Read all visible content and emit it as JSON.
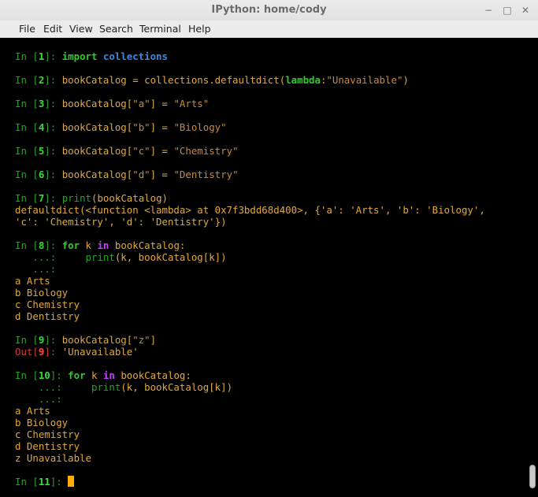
{
  "window": {
    "title": "IPython: home/cody",
    "controls": {
      "minimize": "−",
      "maximize": "□",
      "close": "✕"
    }
  },
  "menu": [
    "File",
    "Edit",
    "View",
    "Search",
    "Terminal",
    "Help"
  ],
  "lines": [
    {
      "kind": "prompt",
      "parts": [
        {
          "t": "In [",
          "c": "g"
        },
        {
          "t": "1",
          "c": "gb"
        },
        {
          "t": "]: ",
          "c": "g"
        },
        {
          "t": "import ",
          "c": "k"
        },
        {
          "t": "collections",
          "c": "b"
        }
      ]
    },
    {
      "kind": "blank"
    },
    {
      "kind": "prompt",
      "parts": [
        {
          "t": "In [",
          "c": "g"
        },
        {
          "t": "2",
          "c": "gb"
        },
        {
          "t": "]: ",
          "c": "g"
        },
        {
          "t": "bookCatalog = collections.defaultdict(",
          "c": "y"
        },
        {
          "t": "lambda",
          "c": "k"
        },
        {
          "t": ":",
          "c": "y"
        },
        {
          "t": "\"Unavailable\"",
          "c": "s"
        },
        {
          "t": ")",
          "c": "y"
        }
      ]
    },
    {
      "kind": "blank"
    },
    {
      "kind": "prompt",
      "parts": [
        {
          "t": "In [",
          "c": "g"
        },
        {
          "t": "3",
          "c": "gb"
        },
        {
          "t": "]: ",
          "c": "g"
        },
        {
          "t": "bookCatalog[",
          "c": "y"
        },
        {
          "t": "\"a\"",
          "c": "s"
        },
        {
          "t": "] = ",
          "c": "y"
        },
        {
          "t": "\"Arts\"",
          "c": "s"
        }
      ]
    },
    {
      "kind": "blank"
    },
    {
      "kind": "prompt",
      "parts": [
        {
          "t": "In [",
          "c": "g"
        },
        {
          "t": "4",
          "c": "gb"
        },
        {
          "t": "]: ",
          "c": "g"
        },
        {
          "t": "bookCatalog[",
          "c": "y"
        },
        {
          "t": "\"b\"",
          "c": "s"
        },
        {
          "t": "] = ",
          "c": "y"
        },
        {
          "t": "\"Biology\"",
          "c": "s"
        }
      ]
    },
    {
      "kind": "blank"
    },
    {
      "kind": "prompt",
      "parts": [
        {
          "t": "In [",
          "c": "g"
        },
        {
          "t": "5",
          "c": "gb"
        },
        {
          "t": "]: ",
          "c": "g"
        },
        {
          "t": "bookCatalog[",
          "c": "y"
        },
        {
          "t": "\"c\"",
          "c": "s"
        },
        {
          "t": "] = ",
          "c": "y"
        },
        {
          "t": "\"Chemistry\"",
          "c": "s"
        }
      ]
    },
    {
      "kind": "blank"
    },
    {
      "kind": "prompt",
      "parts": [
        {
          "t": "In [",
          "c": "g"
        },
        {
          "t": "6",
          "c": "gb"
        },
        {
          "t": "]: ",
          "c": "g"
        },
        {
          "t": "bookCatalog[",
          "c": "y"
        },
        {
          "t": "\"d\"",
          "c": "s"
        },
        {
          "t": "] = ",
          "c": "y"
        },
        {
          "t": "\"Dentistry\"",
          "c": "s"
        }
      ]
    },
    {
      "kind": "blank"
    },
    {
      "kind": "prompt",
      "parts": [
        {
          "t": "In [",
          "c": "g"
        },
        {
          "t": "7",
          "c": "gb"
        },
        {
          "t": "]: ",
          "c": "g"
        },
        {
          "t": "print",
          "c": "g"
        },
        {
          "t": "(bookCatalog)",
          "c": "y"
        }
      ]
    },
    {
      "kind": "output",
      "parts": [
        {
          "t": "defaultdict(<function <lambda> at 0x7f3bdd68d400>, {'a': 'Arts', 'b': 'Biology',",
          "c": "y"
        }
      ]
    },
    {
      "kind": "output",
      "parts": [
        {
          "t": "'c': 'Chemistry', 'd': 'Dentistry'})",
          "c": "y"
        }
      ]
    },
    {
      "kind": "blank"
    },
    {
      "kind": "prompt",
      "parts": [
        {
          "t": "In [",
          "c": "g"
        },
        {
          "t": "8",
          "c": "gb"
        },
        {
          "t": "]: ",
          "c": "g"
        },
        {
          "t": "for ",
          "c": "k"
        },
        {
          "t": "k ",
          "c": "y"
        },
        {
          "t": "in ",
          "c": "p"
        },
        {
          "t": "bookCatalog:",
          "c": "y"
        }
      ]
    },
    {
      "kind": "cont",
      "parts": [
        {
          "t": "   ...: ",
          "c": "g"
        },
        {
          "t": "    ",
          "c": "y"
        },
        {
          "t": "print",
          "c": "g"
        },
        {
          "t": "(k, bookCatalog[k])",
          "c": "y"
        }
      ]
    },
    {
      "kind": "cont",
      "parts": [
        {
          "t": "   ...: ",
          "c": "g"
        }
      ]
    },
    {
      "kind": "output",
      "parts": [
        {
          "t": "a Arts",
          "c": "y"
        }
      ]
    },
    {
      "kind": "output",
      "parts": [
        {
          "t": "b Biology",
          "c": "y"
        }
      ]
    },
    {
      "kind": "output",
      "parts": [
        {
          "t": "c Chemistry",
          "c": "y"
        }
      ]
    },
    {
      "kind": "output",
      "parts": [
        {
          "t": "d Dentistry",
          "c": "y"
        }
      ]
    },
    {
      "kind": "blank"
    },
    {
      "kind": "prompt",
      "parts": [
        {
          "t": "In [",
          "c": "g"
        },
        {
          "t": "9",
          "c": "gb"
        },
        {
          "t": "]: ",
          "c": "g"
        },
        {
          "t": "bookCatalog[",
          "c": "y"
        },
        {
          "t": "\"z\"",
          "c": "s"
        },
        {
          "t": "]",
          "c": "y"
        }
      ]
    },
    {
      "kind": "output",
      "parts": [
        {
          "t": "Out[",
          "c": "r"
        },
        {
          "t": "9",
          "c": "rb"
        },
        {
          "t": "]: ",
          "c": "r"
        },
        {
          "t": "'Unavailable'",
          "c": "y"
        }
      ]
    },
    {
      "kind": "blank"
    },
    {
      "kind": "prompt",
      "parts": [
        {
          "t": "In [",
          "c": "g"
        },
        {
          "t": "10",
          "c": "gb"
        },
        {
          "t": "]: ",
          "c": "g"
        },
        {
          "t": "for ",
          "c": "k"
        },
        {
          "t": "k ",
          "c": "y"
        },
        {
          "t": "in ",
          "c": "p"
        },
        {
          "t": "bookCatalog:",
          "c": "y"
        }
      ]
    },
    {
      "kind": "cont",
      "parts": [
        {
          "t": "    ...: ",
          "c": "g"
        },
        {
          "t": "    ",
          "c": "y"
        },
        {
          "t": "print",
          "c": "g"
        },
        {
          "t": "(k, bookCatalog[k])",
          "c": "y"
        }
      ]
    },
    {
      "kind": "cont",
      "parts": [
        {
          "t": "    ...: ",
          "c": "g"
        }
      ]
    },
    {
      "kind": "output",
      "parts": [
        {
          "t": "a Arts",
          "c": "y"
        }
      ]
    },
    {
      "kind": "output",
      "parts": [
        {
          "t": "b Biology",
          "c": "y"
        }
      ]
    },
    {
      "kind": "output",
      "parts": [
        {
          "t": "c Chemistry",
          "c": "y"
        }
      ]
    },
    {
      "kind": "output",
      "parts": [
        {
          "t": "d Dentistry",
          "c": "y"
        }
      ]
    },
    {
      "kind": "output",
      "parts": [
        {
          "t": "z Unavailable",
          "c": "y"
        }
      ]
    },
    {
      "kind": "blank"
    },
    {
      "kind": "prompt",
      "parts": [
        {
          "t": "In [",
          "c": "g"
        },
        {
          "t": "11",
          "c": "gb"
        },
        {
          "t": "]: ",
          "c": "g"
        }
      ],
      "cursor": true
    }
  ],
  "colors": {
    "terminal_bg": "#000000",
    "prompt_green": "#2aa02a",
    "output_amber": "#e1a93a",
    "out_red": "#c83a3a",
    "cursor": "#ffae00"
  }
}
